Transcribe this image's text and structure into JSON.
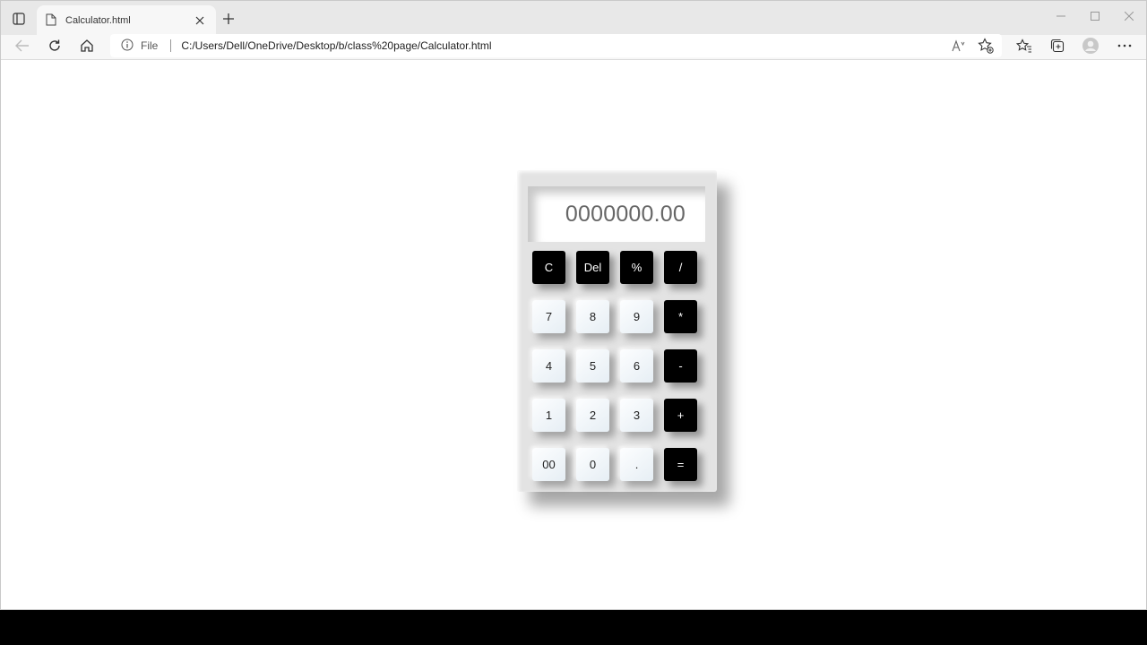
{
  "browser": {
    "tab": {
      "title": "Calculator.html"
    },
    "address": {
      "scheme_label": "File",
      "url": "C:/Users/Dell/OneDrive/Desktop/b/class%20page/Calculator.html"
    }
  },
  "calculator": {
    "display": "0000000.00",
    "rows": [
      [
        {
          "label": "C",
          "style": "dark"
        },
        {
          "label": "Del",
          "style": "dark"
        },
        {
          "label": "%",
          "style": "dark"
        },
        {
          "label": "/",
          "style": "dark"
        }
      ],
      [
        {
          "label": "7",
          "style": "light"
        },
        {
          "label": "8",
          "style": "light"
        },
        {
          "label": "9",
          "style": "light"
        },
        {
          "label": "*",
          "style": "dark"
        }
      ],
      [
        {
          "label": "4",
          "style": "light"
        },
        {
          "label": "5",
          "style": "light"
        },
        {
          "label": "6",
          "style": "light"
        },
        {
          "label": "-",
          "style": "dark"
        }
      ],
      [
        {
          "label": "1",
          "style": "light"
        },
        {
          "label": "2",
          "style": "light"
        },
        {
          "label": "3",
          "style": "light"
        },
        {
          "label": "+",
          "style": "dark"
        }
      ],
      [
        {
          "label": "00",
          "style": "light"
        },
        {
          "label": "0",
          "style": "light"
        },
        {
          "label": ".",
          "style": "light"
        },
        {
          "label": "=",
          "style": "dark"
        }
      ]
    ]
  },
  "icons": {
    "tab_actions": "tab-actions-icon",
    "page": "page-icon",
    "close_tab": "close-icon",
    "new_tab": "plus-icon",
    "minimize": "minimize-icon",
    "maximize": "maximize-icon",
    "close_window": "close-icon",
    "back": "back-arrow-icon",
    "refresh": "refresh-icon",
    "home": "home-icon",
    "info": "info-icon",
    "read_aloud": "read-aloud-icon",
    "add_favorite": "star-plus-icon",
    "favorites": "favorites-icon",
    "collections": "collections-icon",
    "profile": "profile-icon",
    "more": "more-icon"
  }
}
